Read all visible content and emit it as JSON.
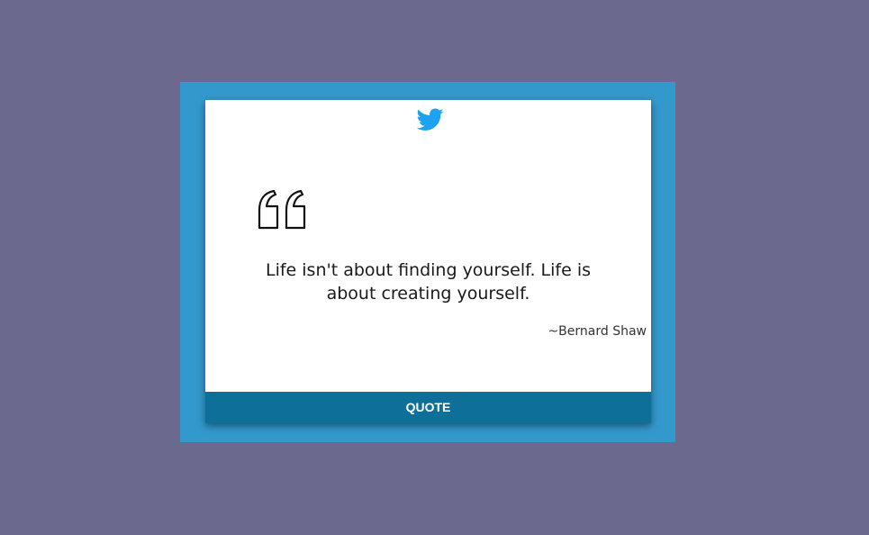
{
  "colors": {
    "page_background": "#6b698e",
    "frame_background": "#3399cc",
    "card_background": "#ffffff",
    "twitter_blue": "#1da1f2",
    "button_background": "#0e6f98",
    "button_text": "#ffffff"
  },
  "icons": {
    "tweet": "twitter-bird-icon",
    "quote_mark": "open-quote-icon"
  },
  "quote": {
    "text": "Life isn't about finding yourself. Life is about creating yourself.",
    "author": "~Bernard Shaw"
  },
  "button": {
    "label": "QUOTE"
  }
}
